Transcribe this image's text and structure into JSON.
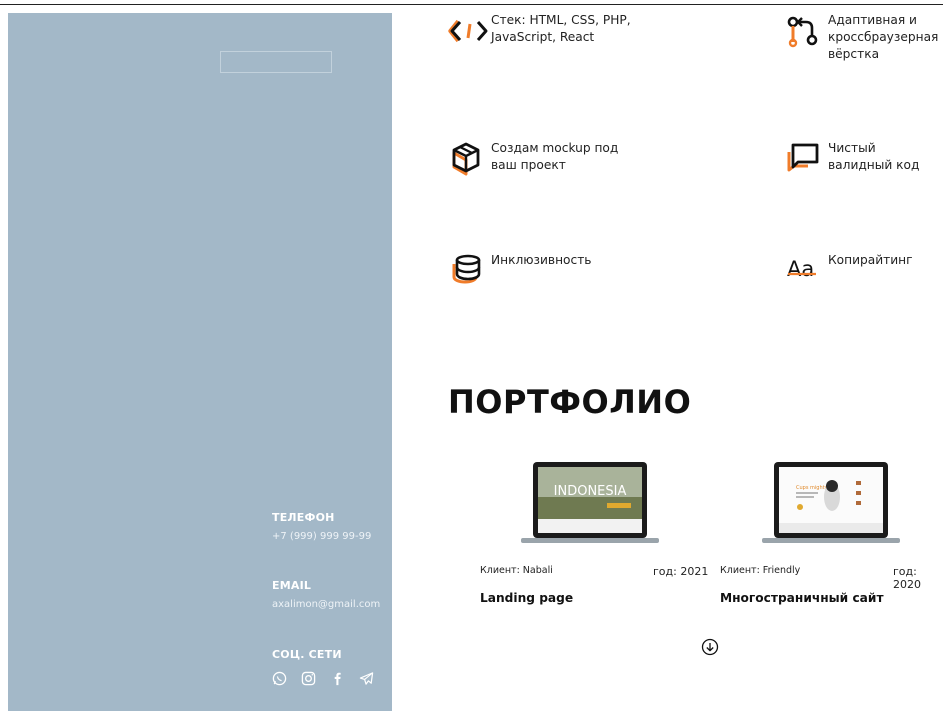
{
  "features": [
    {
      "icon": "code-brackets-icon",
      "text": "Стек: HTML, CSS, PHP, JavaScript, React"
    },
    {
      "icon": "git-branch-icon",
      "text": "Адаптивная и кроссбраузерная вёрстка"
    },
    {
      "icon": "cube-icon",
      "text": "Создам mockup под ваш проект"
    },
    {
      "icon": "chat-bubble-icon",
      "text": "Чистый валидный код"
    },
    {
      "icon": "database-icon",
      "text": "Инклюзивность"
    },
    {
      "icon": "typography-icon",
      "text": "Копирайтинг"
    }
  ],
  "icons": {
    "typography_glyph": "Aa"
  },
  "accent_color": "#f07c2a",
  "sidebar_color": "#a3b8c8",
  "contacts": {
    "phone_label": "ТЕЛЕФОН",
    "phone": "+7 (999) 999 99-99",
    "email_label": "EMAIL",
    "email": "axalimon@gmail.com",
    "social_label": "СОЦ. СЕТИ",
    "socials": [
      "whatsapp-icon",
      "instagram-icon",
      "facebook-icon",
      "telegram-icon"
    ]
  },
  "portfolio": {
    "title": "ПОРТФОЛИО",
    "items": [
      {
        "client": "Клиент: Nabali",
        "year": "год: 2021",
        "type": "Landing page",
        "screen_text": "INDONESIA"
      },
      {
        "client": "Клиент: Friendly",
        "year": "год: 2020",
        "type": "Многостраничный сайт",
        "screen_text": "Cups mighty"
      }
    ]
  }
}
